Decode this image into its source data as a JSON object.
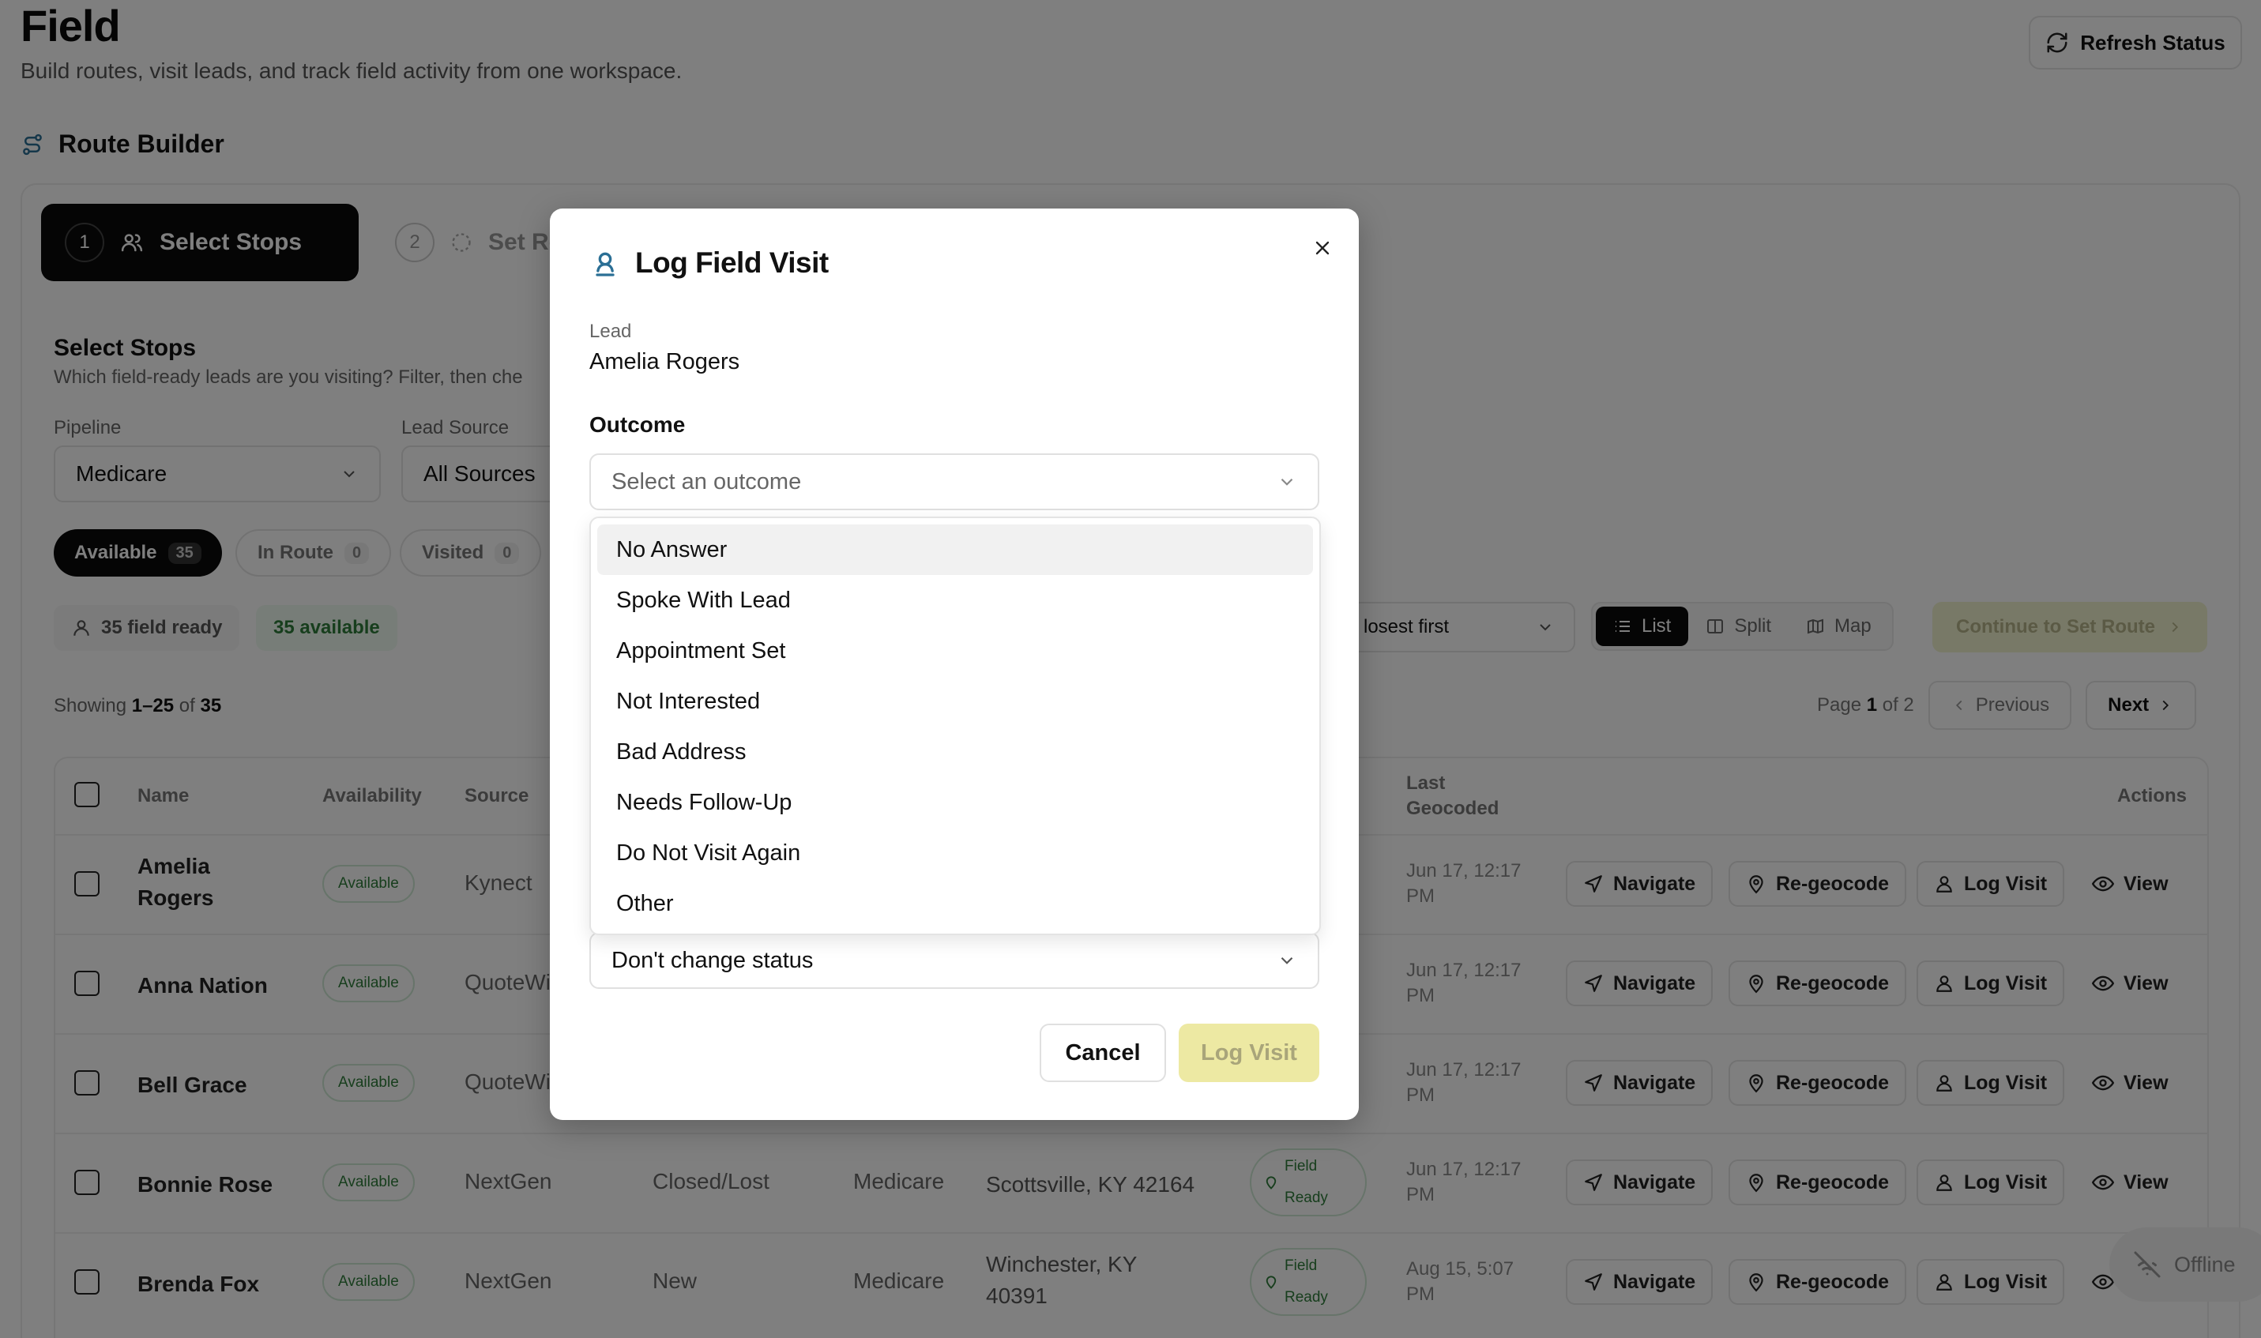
{
  "page": {
    "title": "Field",
    "subtitle": "Build routes, visit leads, and track field activity from one workspace.",
    "refresh_label": "Refresh Status"
  },
  "route_builder": {
    "title": "Route Builder",
    "steps": [
      {
        "num": "1",
        "label": "Select Stops"
      },
      {
        "num": "2",
        "label": "Set Ro"
      }
    ]
  },
  "select_stops": {
    "title": "Select Stops",
    "description": "Which field-ready leads are you visiting? Filter, then che",
    "pipeline_label": "Pipeline",
    "pipeline_value": "Medicare",
    "lead_source_label": "Lead Source",
    "lead_source_value": "All Sources"
  },
  "status_tabs": [
    {
      "label": "Available",
      "count": "35"
    },
    {
      "label": "In Route",
      "count": "0"
    },
    {
      "label": "Visited",
      "count": "0"
    }
  ],
  "summary": {
    "field_ready": "35 field ready",
    "available": "35 available"
  },
  "sort": {
    "value": "losest first"
  },
  "view_modes": [
    "List",
    "Split",
    "Map"
  ],
  "continue_label": "Continue to Set Route",
  "showing": {
    "prefix": "Showing ",
    "range": "1–25",
    "mid": " of ",
    "total": "35"
  },
  "pagination": {
    "page_prefix": "Page ",
    "page": "1",
    "of": " of 2",
    "previous": "Previous",
    "next": "Next"
  },
  "table": {
    "headers": {
      "name": "Name",
      "availability": "Availability",
      "source": "Source",
      "last_geocoded": "Last\nGeocoded",
      "actions": "Actions"
    },
    "rows": [
      {
        "name": "Amelia\nRogers",
        "availability": "Available",
        "source": "Kynect",
        "status": "",
        "pipeline": "",
        "address": "",
        "field": "",
        "geocoded": "Jun 17, 12:17\nPM"
      },
      {
        "name": "Anna Nation",
        "availability": "Available",
        "source": "QuoteWi",
        "status": "",
        "pipeline": "",
        "address": "",
        "field": "",
        "geocoded": "Jun 17, 12:17\nPM"
      },
      {
        "name": "Bell Grace",
        "availability": "Available",
        "source": "QuoteWi",
        "status": "",
        "pipeline": "",
        "address": "",
        "field": "",
        "geocoded": "Jun 17, 12:17\nPM"
      },
      {
        "name": "Bonnie Rose",
        "availability": "Available",
        "source": "NextGen",
        "status": "Closed/Lost",
        "pipeline": "Medicare",
        "address": "Scottsville, KY 42164",
        "field": "Field\nReady",
        "geocoded": "Jun 17, 12:17\nPM"
      },
      {
        "name": "Brenda Fox",
        "availability": "Available",
        "source": "NextGen",
        "status": "New",
        "pipeline": "Medicare",
        "address": "Winchester, KY\n40391",
        "field": "Field\nReady",
        "geocoded": "Aug 15, 5:07\nPM"
      }
    ],
    "actions": {
      "navigate": "Navigate",
      "regeocode": "Re-geocode",
      "log_visit": "Log Visit",
      "view": "View"
    }
  },
  "offline_label": "Offline",
  "modal": {
    "title": "Log Field Visit",
    "lead_label": "Lead",
    "lead_value": "Amelia Rogers",
    "outcome_label": "Outcome",
    "outcome_placeholder": "Select an outcome",
    "outcome_options": [
      "No Answer",
      "Spoke With Lead",
      "Appointment Set",
      "Not Interested",
      "Bad Address",
      "Needs Follow-Up",
      "Do Not Visit Again",
      "Other"
    ],
    "status_value": "Don't change status",
    "cancel_label": "Cancel",
    "submit_label": "Log Visit"
  },
  "colors": {
    "accent": "#0a0a0a",
    "success": "#2f7d3a",
    "disabled_submit": "#ede9a3",
    "modal_icon": "#2b6f95"
  }
}
